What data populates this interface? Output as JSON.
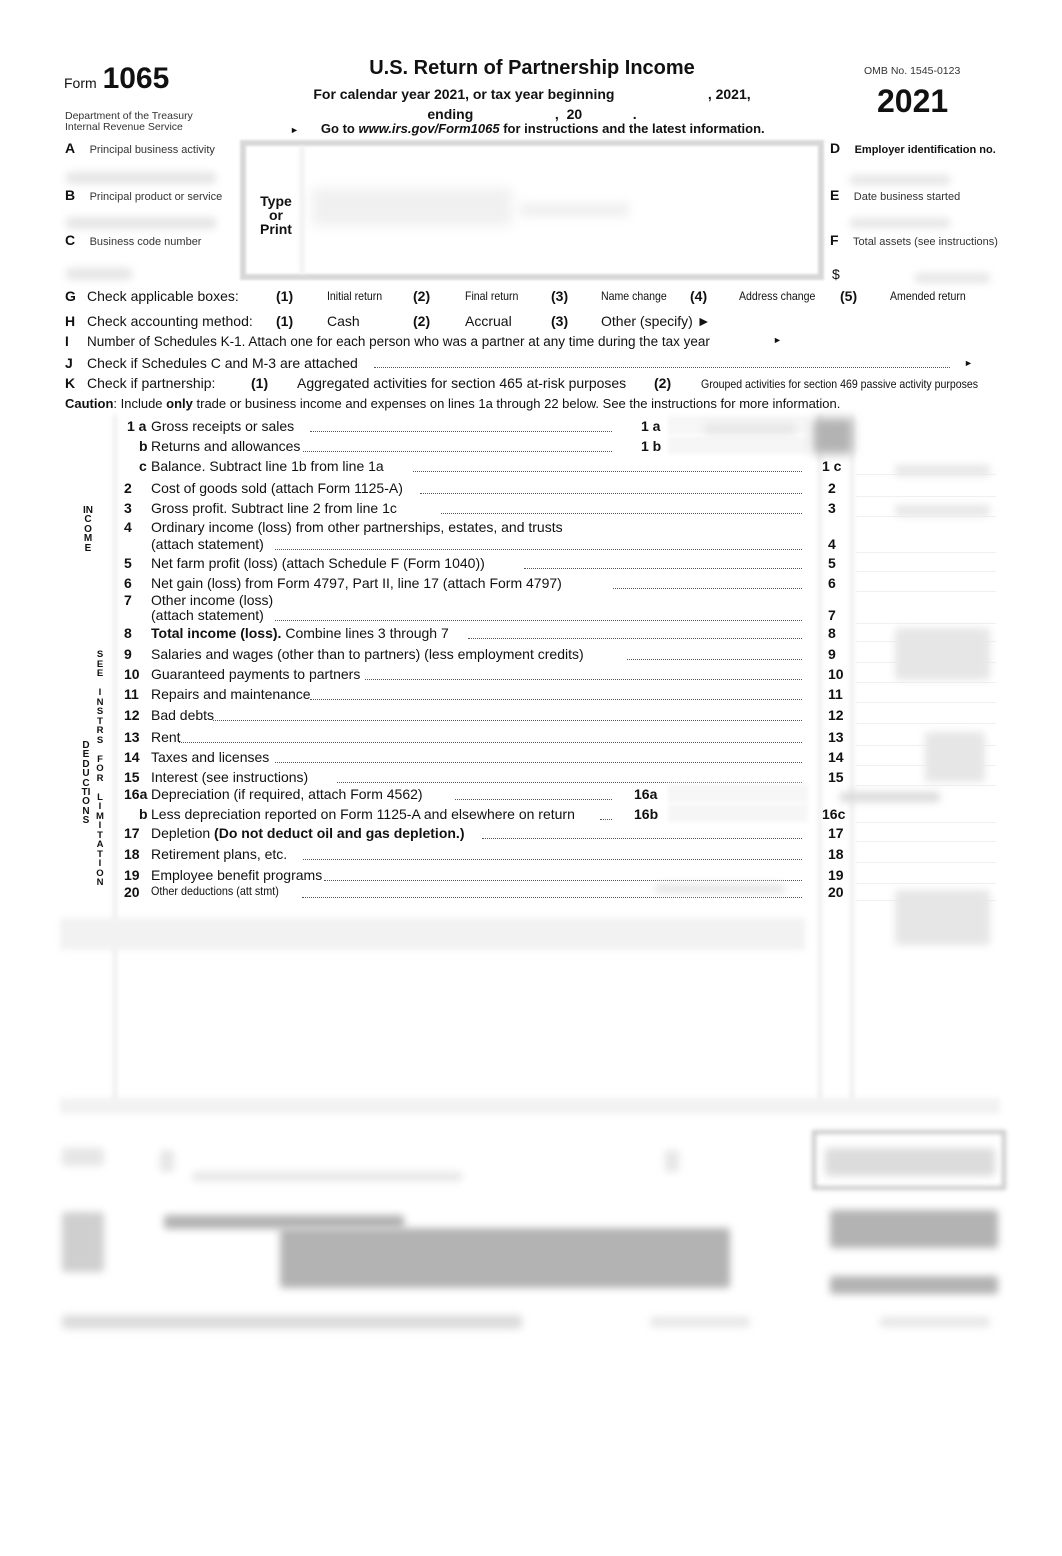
{
  "header": {
    "form_word": "Form",
    "form_number": "1065",
    "department": "Department of the Treasury",
    "agency": "Internal Revenue Service",
    "title": "U.S. Return of Partnership Income",
    "subtitle_line1": "For calendar year 2021, or tax year beginning                        , 2021,",
    "subtitle_line2": "ending                     ,  20             .",
    "goto_prefix": "Go to ",
    "goto_url": "www.irs.gov/Form1065",
    "goto_suffix": " for instructions and the latest information.",
    "arrow": "►",
    "omb": "OMB No. 1545-0123",
    "year": "2021"
  },
  "id_fields": {
    "A": {
      "letter": "A",
      "label": "Principal business activity",
      "value_redacted": true
    },
    "B": {
      "letter": "B",
      "label": "Principal product or service",
      "value_redacted": true
    },
    "C": {
      "letter": "C",
      "label": "Business code number",
      "value_redacted": true
    },
    "D": {
      "letter": "D",
      "label": "Employer identification no.",
      "value_redacted": true
    },
    "E": {
      "letter": "E",
      "label": "Date business started",
      "value_redacted": true
    },
    "F": {
      "letter": "F",
      "label": "Total assets (see instructions)",
      "currency": "$",
      "value_redacted": true
    },
    "type_or_print": [
      "Type",
      "or",
      "Print"
    ],
    "name_address_redacted": true
  },
  "checks": {
    "G": {
      "letter": "G",
      "label": "Check applicable boxes:",
      "options": [
        {
          "num": "(1)",
          "label": "Initial return"
        },
        {
          "num": "(2)",
          "label": "Final return"
        },
        {
          "num": "(3)",
          "label": "Name change"
        },
        {
          "num": "(4)",
          "label": "Address change"
        },
        {
          "num": "(5)",
          "label": "Amended return"
        }
      ]
    },
    "H": {
      "letter": "H",
      "label": "Check accounting method:",
      "options": [
        {
          "num": "(1)",
          "label": "Cash"
        },
        {
          "num": "(2)",
          "label": "Accrual"
        },
        {
          "num": "(3)",
          "label": "Other (specify) ►"
        }
      ]
    },
    "I": {
      "letter": "I",
      "label": "Number of Schedules K-1. Attach one for each person who was a partner at any time during the tax year",
      "arrow": "►"
    },
    "J": {
      "letter": "J",
      "label": "Check if Schedules C and M-3 are attached",
      "arrow": "►"
    },
    "K": {
      "letter": "K",
      "label": "Check if partnership:",
      "options": [
        {
          "num": "(1)",
          "label": "Aggregated activities for section 465 at-risk purposes"
        },
        {
          "num": "(2)",
          "label": "Grouped activities for section 469 passive activity purposes"
        }
      ]
    }
  },
  "caution": {
    "lead": "Caution",
    "text1": ": Include ",
    "bold": "only",
    "text2": " trade or business income and expenses on lines 1a through 22 below. See the instructions for more information."
  },
  "side_labels": {
    "income": "INCOME",
    "deductions": "DEDUCTIONS",
    "see_instrs": "SEE INSTRS FOR LIMITATIONS"
  },
  "income_lines": [
    {
      "num": "1 a",
      "label": "Gross receipts or sales",
      "ref": "1 a",
      "inner": true,
      "amount_redacted": true
    },
    {
      "num": "b",
      "label": "Returns and allowances",
      "ref": "1 b",
      "inner": true
    },
    {
      "num": "c",
      "label": "Balance. Subtract line 1b from line 1a",
      "ref": "1 c",
      "amount_redacted": true
    },
    {
      "num": "2",
      "label": "Cost of goods sold (attach Form 1125-A)",
      "ref": "2"
    },
    {
      "num": "3",
      "label": "Gross profit. Subtract line 2 from line 1c",
      "ref": "3",
      "amount_redacted": true
    },
    {
      "num": "4",
      "label": "Ordinary income (loss) from other partnerships, estates, and trusts",
      "label2": "(attach statement)",
      "ref": "4"
    },
    {
      "num": "5",
      "label": "Net farm profit (loss) (attach Schedule F (Form 1040))",
      "ref": "5"
    },
    {
      "num": "6",
      "label": "Net gain (loss) from Form 4797, Part II, line 17 (attach Form 4797)",
      "ref": "6"
    },
    {
      "num": "7",
      "label": "Other income (loss)",
      "label2": "(attach statement)",
      "ref": "7"
    },
    {
      "num": "8",
      "label_bold": "Total income (loss).",
      "label": " Combine lines 3 through 7",
      "ref": "8",
      "amount_redacted": true
    }
  ],
  "deduction_lines": [
    {
      "num": "9",
      "label": "Salaries and wages (other than to partners) (less employment credits)",
      "ref": "9",
      "amount_redacted": true
    },
    {
      "num": "10",
      "label": "Guaranteed payments to partners",
      "ref": "10",
      "amount_redacted": true
    },
    {
      "num": "11",
      "label": "Repairs and maintenance",
      "ref": "11"
    },
    {
      "num": "12",
      "label": "Bad debts",
      "ref": "12"
    },
    {
      "num": "13",
      "label": "Rent",
      "ref": "13",
      "amount_redacted": true
    },
    {
      "num": "14",
      "label": "Taxes and licenses",
      "ref": "14",
      "amount_redacted": true
    },
    {
      "num": "15",
      "label": "Interest (see instructions)",
      "ref": "15",
      "amount_redacted": true
    },
    {
      "num": "16a",
      "label": "Depreciation (if required, attach Form 4562)",
      "ref": "16a",
      "inner": true
    },
    {
      "num": "b",
      "label": "Less depreciation reported on Form 1125-A and elsewhere on return",
      "ref": "16b",
      "inner": true,
      "outer_ref": "16c"
    },
    {
      "num": "17",
      "label": "Depletion ",
      "label_bold_after": "(Do not deduct oil and gas depletion.)",
      "ref": "17"
    },
    {
      "num": "18",
      "label": "Retirement plans, etc.",
      "ref": "18"
    },
    {
      "num": "19",
      "label": "Employee benefit programs",
      "ref": "19"
    },
    {
      "num": "20",
      "label": "Other deductions (att stmt)",
      "ref": "20",
      "narrow": true,
      "amount_redacted": true
    }
  ],
  "lower_section_redacted": true
}
